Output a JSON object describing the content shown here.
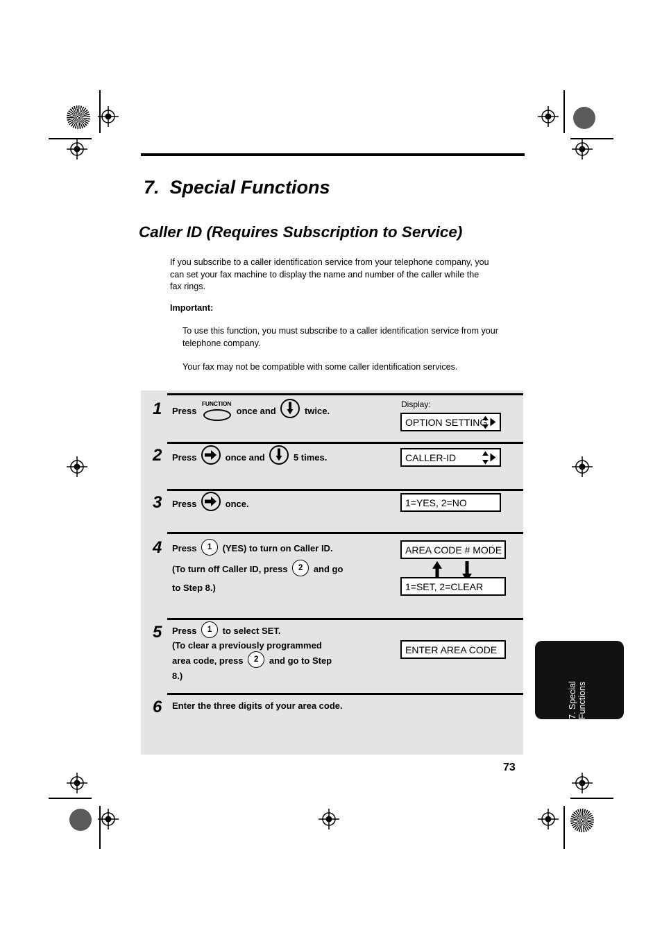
{
  "document": {
    "chapter_title": "7.  Special Functions",
    "section_title": "Caller ID (Requires Subscription to Service)",
    "intro": "If you subscribe to a caller identification service from your telephone company, you can set your fax machine to display the name and number of the caller while the fax rings.",
    "important_label": "Important:",
    "important_note_1": "To use this function, you must subscribe to a caller identification service from your telephone company.",
    "important_note_2": "Your fax may not be compatible with some caller identification services.",
    "page_number": "73",
    "side_tab_label": "7. Special\nFunctions"
  },
  "display_label": "Display:",
  "icons": {
    "function_key_label": "FUNCTION",
    "down_arrow_key": "down-arrow-key-icon",
    "right_arrow_key": "right-arrow-key-icon",
    "key_1": "1",
    "key_2": "2"
  },
  "steps": [
    {
      "number": "1",
      "text_parts": [
        "Press ",
        "[FUNCTION]",
        " once and ",
        "[DOWN]",
        " twice."
      ],
      "display": "OPTION SETTING",
      "display_arrows": "updown-right"
    },
    {
      "number": "2",
      "text_parts": [
        "Press ",
        "[RIGHT]",
        " once and ",
        "[DOWN]",
        " 5 times."
      ],
      "display": "CALLER-ID",
      "display_arrows": "updown-right"
    },
    {
      "number": "3",
      "text_parts": [
        "Press ",
        "[RIGHT]",
        " once."
      ],
      "display": "1=YES, 2=NO",
      "display_arrows": "none"
    },
    {
      "number": "4",
      "line1": [
        "Press ",
        "[1]",
        " (YES) to turn on Caller ID."
      ],
      "line2": [
        "(To turn off Caller ID, press ",
        "[2]",
        " and go"
      ],
      "line3": [
        "to Step 8.)"
      ],
      "display_top": "AREA CODE # MODE",
      "display_bottom": "1=SET, 2=CLEAR"
    },
    {
      "number": "5",
      "line1": [
        "Press ",
        "[1]",
        " to select SET."
      ],
      "line2": [
        "(To clear a previously programmed"
      ],
      "line3": [
        "area code, press ",
        "[2]",
        " and go to Step"
      ],
      "line4": [
        "8.)"
      ],
      "display": "ENTER AREA CODE"
    },
    {
      "number": "6",
      "text": "Enter the three digits of your area code."
    }
  ]
}
